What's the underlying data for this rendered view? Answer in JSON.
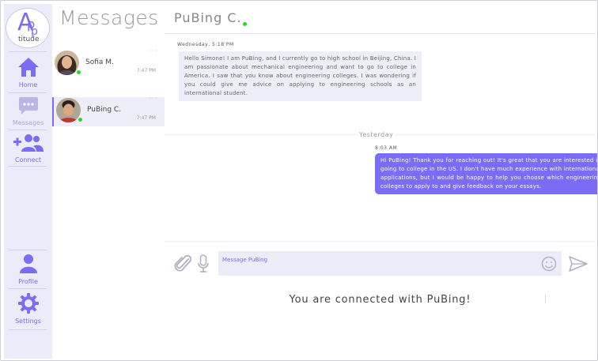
{
  "app": {
    "logo_letter_big": "A",
    "logo_letter_small": "p",
    "logo_word": "titude"
  },
  "nav": {
    "home": "Home",
    "messages": "Messages",
    "connect": "Connect",
    "profile": "Profile",
    "settings": "Settings"
  },
  "list": {
    "title": "Messages",
    "conversations": [
      {
        "name": "Sofia M.",
        "time": "7:47 PM",
        "dots": "···",
        "online": true
      },
      {
        "name": "PuBing C.",
        "time": "7:47 PM",
        "dots": "···",
        "online": true,
        "active": true
      }
    ]
  },
  "chat": {
    "contact_name": "PuBing C.",
    "messages": [
      {
        "direction": "in",
        "timestamp": "Wednesday, 5:18 PM",
        "text": "Hello Simone! I am PuBing, and I currently go to high school in Beijing, China. I am passionate about mechanical engineering and want to go to college in America. I saw that you know about engineering colleges. I was wondering if you could give me advice on applying to engineering schools as an international student."
      },
      {
        "direction": "out",
        "timestamp": "8:03 AM",
        "text": "Hi PuBing! Thank you for reaching out! It's great that you are interested in going to college in the US. I don't have much experience with international applications, but I would be happy to help you choose which engineering colleges to apply to and give feedback on your essays."
      }
    ],
    "day_separator": "Yesterday",
    "input_placeholder": "Message PuBing",
    "connected_text": "You are connected with PuBing!"
  },
  "colors": {
    "accent": "#7b6cf5",
    "rail_bg": "#ebebf9",
    "online": "#22dd22"
  },
  "icons": [
    "home-icon",
    "chat-bubble-icon",
    "add-people-icon",
    "person-icon",
    "gear-icon",
    "paperclip-icon",
    "microphone-icon",
    "smiley-icon",
    "send-icon"
  ]
}
